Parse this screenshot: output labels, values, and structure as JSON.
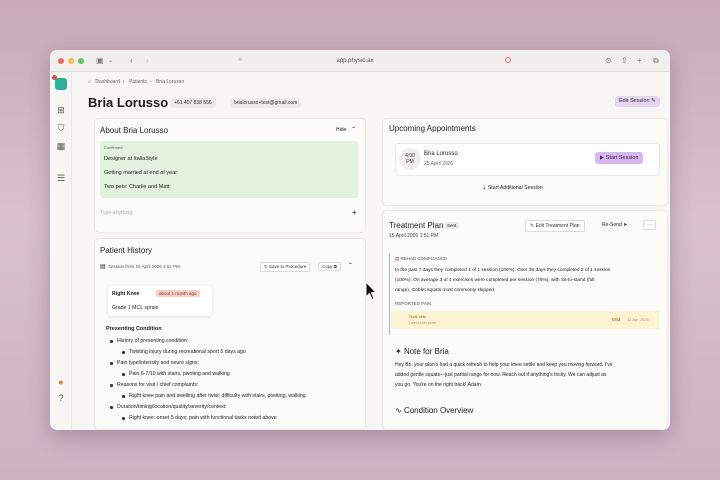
{
  "browser": {
    "url": "app.physio.ax",
    "colors": {
      "close": "#ed6a5e",
      "minimize": "#f5bf4f",
      "maximize": "#61c454"
    }
  },
  "breadcrumb": [
    "Dashboard",
    "Patients",
    "Bria Lorusso"
  ],
  "patient": {
    "name": "Bria Lorusso",
    "phone": "+61 407 838 556",
    "email": "brialorusso+test@gmail.com"
  },
  "header": {
    "edit_session": "Edit Session"
  },
  "about": {
    "title": "About Bria Lorusso",
    "hide": "Hide",
    "section_label": "Confirmed",
    "lines": [
      "Designer at ItaliaStyle",
      "Getting married at end of year",
      "Two pets: Charlie and Matt"
    ],
    "placeholder": "Type anything"
  },
  "history": {
    "title": "Patient History",
    "session_label": "Session from 15 April 2026 1:51 PM",
    "save_btn": "Save to Procedure",
    "copy_btn": "Copy",
    "injury_title": "Right Knee",
    "injury_badge": "about 1 month ago",
    "injury_detail": "Grade 1 MCL sprain",
    "presenting_title": "Presenting Condition",
    "items": [
      {
        "text": "History of presenting condition:",
        "level": 1
      },
      {
        "text": "Twisting injury during recreational sport 5 days ago",
        "level": 2
      },
      {
        "text": "Pain type/intensity and neuro signs:",
        "level": 1
      },
      {
        "text": "Pain 6-7/10 with stairs, pivoting and walking",
        "level": 2
      },
      {
        "text": "Reasons for visit / chief complaints:",
        "level": 1
      },
      {
        "text": "Right knee pain and swelling after twist; difficulty with stairs, pivoting, walking",
        "level": 2
      },
      {
        "text": "Duration/timing/location/quality/severity/context:",
        "level": 1
      },
      {
        "text": "Right knee: onset 5 days; pain with functional tasks noted above",
        "level": 2
      }
    ]
  },
  "appointments": {
    "title": "Upcoming Appointments",
    "time": "4:00",
    "ampm": "PM",
    "patient": "Bria Lorusso",
    "date": "25 April 2026",
    "start_btn": "Start Session",
    "additional_btn": "Start Additional Session"
  },
  "treatment": {
    "title": "Treatment Plan",
    "status": "Sent",
    "date": "15 April 2026 1:51 PM",
    "edit_btn": "Edit Treatment Plan",
    "resend_btn": "Re-Send",
    "compliance_label": "REHAB COMPLIANCE",
    "compliance_lines": [
      "In the past 7 days they completed 1 of 1 session (100%). Over 30 days they completed 2 of 1 session",
      "(100%). On average 3 of 4 exercises were completed per session (75%), with Sit-to-stand (full",
      "range), Goblet squats most commonly skipped."
    ],
    "reported_pain_label": "REPORTED PAIN",
    "pain_title": "Goal sets",
    "pain_sub": "Latest pain score",
    "pain_level": "Mild",
    "pain_date": "14 Apr 2026"
  },
  "note": {
    "title": "Note for Bria",
    "lines": [
      "Hey Bri, your plan's had a quick refresh to help your knee settle and keep you moving forward. I've",
      "added gentle squats—just partial range for now. Reach out if anything's tricky. We can adjust as",
      "you go. You're on the right track! Adam"
    ]
  },
  "condition": {
    "title": "Condition Overview"
  }
}
